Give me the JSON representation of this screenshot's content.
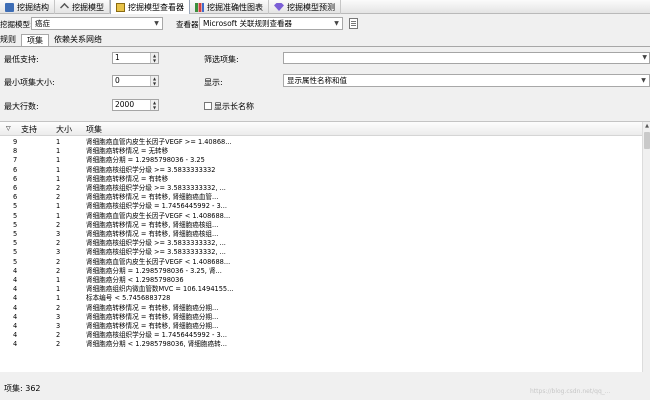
{
  "top_tabs": [
    {
      "label": "挖掘结构",
      "icon": "mining-structure-icon"
    },
    {
      "label": "挖掘模型",
      "icon": "mining-model-icon"
    },
    {
      "label": "挖掘模型查看器",
      "icon": "model-viewer-icon",
      "active": true
    },
    {
      "label": "挖掘准确性图表",
      "icon": "accuracy-chart-icon"
    },
    {
      "label": "挖掘模型预测",
      "icon": "model-prediction-icon"
    }
  ],
  "model_row": {
    "model_label": "挖掘模型:",
    "model_value": "癌症",
    "viewer_label": "查看器:",
    "viewer_value": "Microsoft 关联规则查看器"
  },
  "sub_tabs": [
    "规则",
    "项集",
    "依赖关系网络"
  ],
  "params": {
    "min_support_label": "最低支持:",
    "min_support_value": "1",
    "min_itemset_size_label": "最小项集大小:",
    "min_itemset_size_value": "0",
    "max_rows_label": "最大行数:",
    "max_rows_value": "2000",
    "filter_label": "筛选项集:",
    "filter_value": "",
    "display_label": "显示:",
    "display_value": "显示属性名称和值",
    "show_long_name_label": "显示长名称"
  },
  "grid": {
    "headers": [
      "支持",
      "大小",
      "项集"
    ],
    "rows": [
      {
        "support": "9",
        "size": "1",
        "itemset": "肾细胞癌血管内皮生长因子VEGF >= 1.40868..."
      },
      {
        "support": "8",
        "size": "1",
        "itemset": "肾细胞癌转移情况 = 无转移"
      },
      {
        "support": "7",
        "size": "1",
        "itemset": "肾细胞癌分期 = 1.2985798036 - 3.25"
      },
      {
        "support": "6",
        "size": "1",
        "itemset": "肾细胞癌核组织学分级 >= 3.5833333332"
      },
      {
        "support": "6",
        "size": "1",
        "itemset": "肾细胞癌转移情况 = 有转移"
      },
      {
        "support": "6",
        "size": "2",
        "itemset": "肾细胞癌核组织学分级 >= 3.5833333332, ..."
      },
      {
        "support": "6",
        "size": "2",
        "itemset": "肾细胞癌转移情况 = 有转移, 肾细胞癌血管..."
      },
      {
        "support": "5",
        "size": "1",
        "itemset": "肾细胞癌核组织学分级 = 1.7456445992 - 3..."
      },
      {
        "support": "5",
        "size": "1",
        "itemset": "肾细胞癌血管内皮生长因子VEGF < 1.408688..."
      },
      {
        "support": "5",
        "size": "2",
        "itemset": "肾细胞癌转移情况 = 有转移, 肾细胞癌核组..."
      },
      {
        "support": "5",
        "size": "3",
        "itemset": "肾细胞癌转移情况 = 有转移, 肾细胞癌核组..."
      },
      {
        "support": "5",
        "size": "2",
        "itemset": "肾细胞癌核组织学分级 >= 3.5833333332, ..."
      },
      {
        "support": "5",
        "size": "3",
        "itemset": "肾细胞癌核组织学分级 >= 3.5833333332, ..."
      },
      {
        "support": "5",
        "size": "2",
        "itemset": "肾细胞癌血管内皮生长因子VEGF < 1.408688..."
      },
      {
        "support": "4",
        "size": "2",
        "itemset": "肾细胞癌分期 = 1.2985798036 - 3.25, 肾..."
      },
      {
        "support": "4",
        "size": "1",
        "itemset": "肾细胞癌分期 < 1.2985798036"
      },
      {
        "support": "4",
        "size": "1",
        "itemset": "肾细胞癌组织内微血管数MVC = 106.1494155..."
      },
      {
        "support": "4",
        "size": "1",
        "itemset": "标本编号 < 5.7456883728"
      },
      {
        "support": "4",
        "size": "2",
        "itemset": "肾细胞癌转移情况 = 有转移, 肾细胞癌分期..."
      },
      {
        "support": "4",
        "size": "3",
        "itemset": "肾细胞癌转移情况 = 有转移, 肾细胞癌分期..."
      },
      {
        "support": "4",
        "size": "3",
        "itemset": "肾细胞癌转移情况 = 有转移, 肾细胞癌分期..."
      },
      {
        "support": "4",
        "size": "2",
        "itemset": "肾细胞癌核组织学分级 = 1.7456445992 - 3..."
      },
      {
        "support": "4",
        "size": "2",
        "itemset": "肾细胞癌分期 < 1.2985798036, 肾细胞癌转..."
      }
    ]
  },
  "status": "项集:  362",
  "watermark": "https://blog.csdn.net/qq_..."
}
